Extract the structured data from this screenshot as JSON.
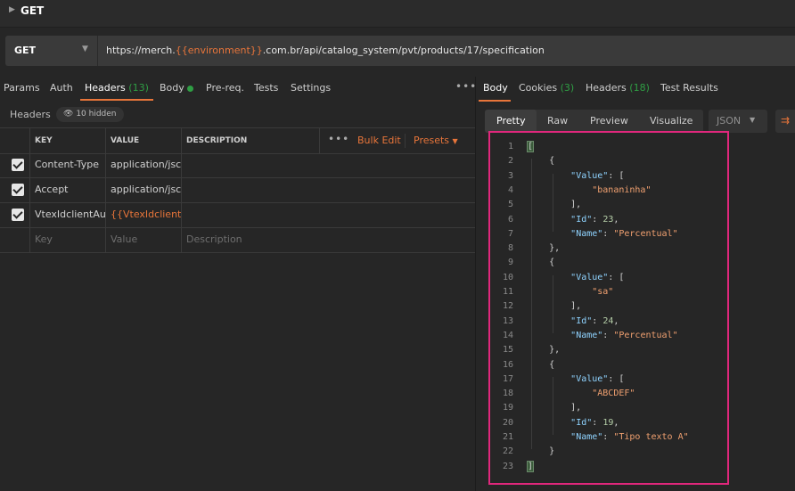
{
  "topbar": {
    "title": "GET"
  },
  "request": {
    "method": "GET",
    "url_prefix": "https://merch.",
    "url_var": "{{environment}}",
    "url_suffix": ".com.br/api/catalog_system/pvt/products/17/specification"
  },
  "left_tabs": {
    "params": "Params",
    "auth": "Auth",
    "headers": "Headers",
    "headers_count": "(13)",
    "body": "Body",
    "prereq": "Pre-req.",
    "tests": "Tests",
    "settings": "Settings",
    "more": "•••"
  },
  "headers_section": {
    "label": "Headers",
    "hidden": "10 hidden"
  },
  "table": {
    "columns": {
      "key": "KEY",
      "value": "VALUE",
      "description": "DESCRIPTION"
    },
    "more": "•••",
    "bulk_edit": "Bulk Edit",
    "presets": "Presets",
    "rows": [
      {
        "key": "Content-Type",
        "value": "application/jsc"
      },
      {
        "key": "Accept",
        "value": "application/jsc"
      },
      {
        "key": "VtexIdclientAu",
        "value": "{{VtexIdclientA"
      }
    ],
    "placeholders": {
      "key": "Key",
      "value": "Value",
      "description": "Description"
    }
  },
  "right_tabs": {
    "body": "Body",
    "cookies": "Cookies",
    "cookies_count": "(3)",
    "headers": "Headers",
    "headers_count": "(18)",
    "test_results": "Test Results"
  },
  "view_tabs": {
    "pretty": "Pretty",
    "raw": "Raw",
    "preview": "Preview",
    "visualize": "Visualize"
  },
  "format_select": "JSON",
  "code_lines": [
    "[",
    "    {",
    "        \"Value\": [",
    "            \"bananinha\"",
    "        ],",
    "        \"Id\": 23,",
    "        \"Name\": \"Percentual\"",
    "    },",
    "    {",
    "        \"Value\": [",
    "            \"sa\"",
    "        ],",
    "        \"Id\": 24,",
    "        \"Name\": \"Percentual\"",
    "    },",
    "    {",
    "        \"Value\": [",
    "            \"ABCDEF\"",
    "        ],",
    "        \"Id\": 19,",
    "        \"Name\": \"Tipo texto A\"",
    "    }",
    "]"
  ],
  "colors": {
    "accent": "#e8753a",
    "highlight_border": "#e0277c",
    "count_green": "#2f9e44"
  }
}
